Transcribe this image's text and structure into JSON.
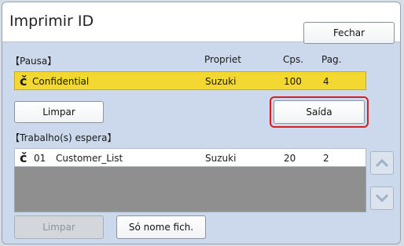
{
  "window": {
    "title": "Imprimir ID",
    "close_label": "Fechar"
  },
  "held_section": {
    "title": "【Pausa】",
    "columns": {
      "owner": "Propriet",
      "copies": "Cps.",
      "pages": "Pag."
    },
    "job": {
      "icon": "key-icon",
      "name": "Confidential",
      "owner": "Suzuki",
      "copies": "100",
      "pages": "4"
    },
    "clear_label": "Limpar",
    "output_label": "Saída"
  },
  "waiting_section": {
    "title": "【Trabalho(s) espera】",
    "jobs": [
      {
        "icon": "key-icon",
        "number": "01",
        "name": "Customer_List",
        "owner": "Suzuki",
        "copies": "20",
        "pages": "2"
      }
    ],
    "clear_label": "Limpar",
    "filename_only_label": "Só nome fich."
  },
  "colors": {
    "selected_row": "#f4d832",
    "highlight_border": "#d42020",
    "panel_background": "#ccd9ec"
  }
}
